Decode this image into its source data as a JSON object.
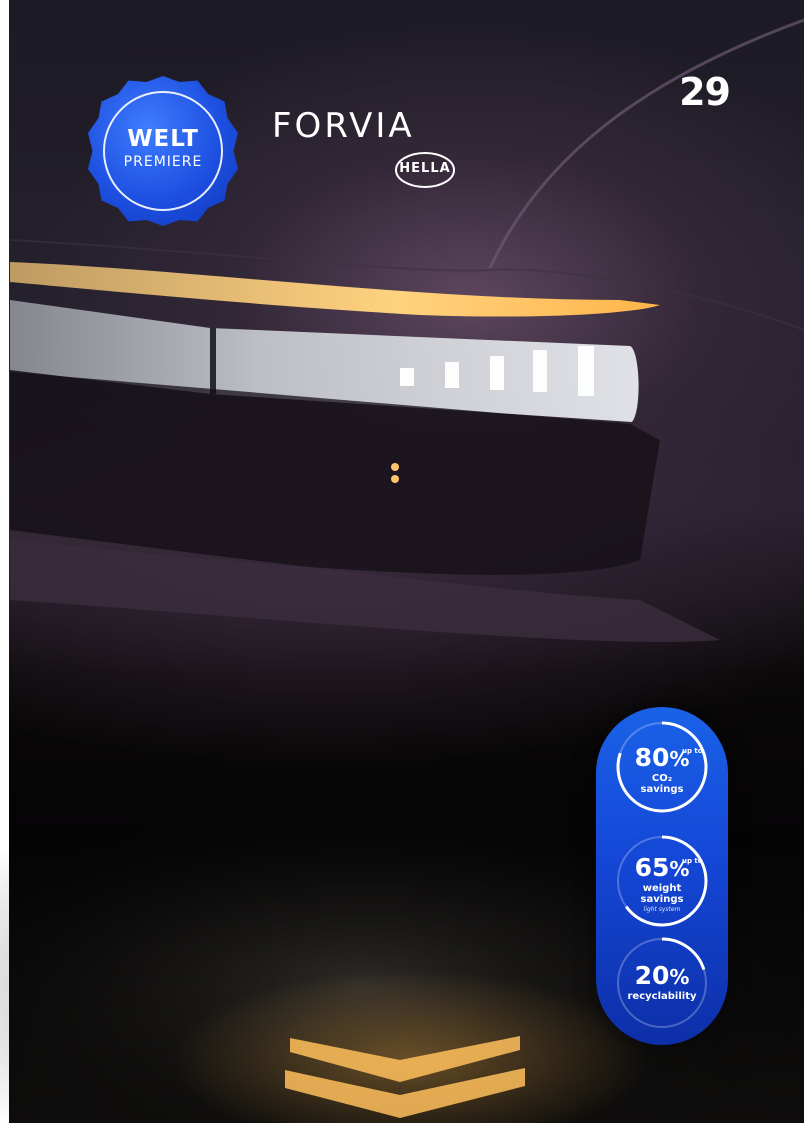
{
  "page": {
    "number": "29"
  },
  "badge": {
    "line1": "WELT",
    "line2": "PREMIERE",
    "color": "#1d4fe0"
  },
  "brand": {
    "forvia": "FORVIA",
    "hella": "HELLA"
  },
  "projection_text": "FORVIA",
  "stats": [
    {
      "value": "80",
      "unit": "%",
      "prefix": "up to",
      "label_main": "CO₂",
      "label_secondary": "savings",
      "note": "",
      "level": 0.8
    },
    {
      "value": "65",
      "unit": "%",
      "prefix": "up to",
      "label_main": "weight",
      "label_secondary": "savings",
      "note": "light system",
      "level": 0.65
    },
    {
      "value": "20",
      "unit": "%",
      "prefix": "",
      "label_main": "recyclability",
      "label_secondary": "",
      "note": "",
      "level": 0.2
    }
  ],
  "colors": {
    "accent": "#1a62e8",
    "light_amber": "#ffb54a",
    "light_white": "#e8ecf0"
  }
}
